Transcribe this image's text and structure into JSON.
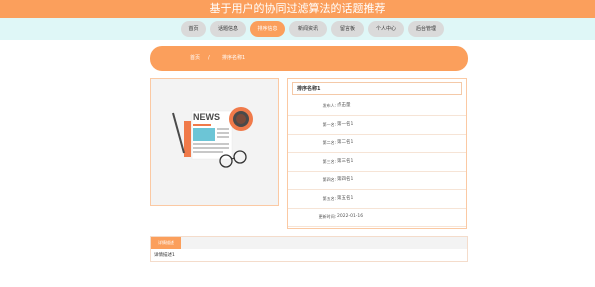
{
  "header": {
    "title": "基于用户的协同过滤算法的话题推荐"
  },
  "nav": {
    "items": [
      {
        "label": "首页",
        "name": "nav-home"
      },
      {
        "label": "话题信息",
        "name": "nav-topic-info"
      },
      {
        "label": "排序信息",
        "name": "nav-ranking-info",
        "active": true
      },
      {
        "label": "新闻资讯",
        "name": "nav-news"
      },
      {
        "label": "留言板",
        "name": "nav-message-board"
      },
      {
        "label": "个人中心",
        "name": "nav-user-center"
      },
      {
        "label": "后台管理",
        "name": "nav-admin"
      }
    ]
  },
  "breadcrumb": {
    "home": "首页",
    "separator": "/",
    "current": "排序名称1"
  },
  "detail": {
    "title": "排序名称1",
    "fields": [
      {
        "label": "发布人:",
        "value": "点击量"
      },
      {
        "label": "第一名:",
        "value": "第一名1"
      },
      {
        "label": "第二名:",
        "value": "第二名1"
      },
      {
        "label": "第三名:",
        "value": "第三名1"
      },
      {
        "label": "第四名:",
        "value": "第四名1"
      },
      {
        "label": "第五名:",
        "value": "第五名1"
      },
      {
        "label": "更新时间:",
        "value": "2022-01-16"
      }
    ]
  },
  "description": {
    "tab": "详情描述",
    "text": "详情描述1"
  },
  "image_alt_text": "NEWS",
  "colors": {
    "accent": "#fb9f5c",
    "nav_band": "#dff7f7",
    "nav_inactive": "#dadada"
  }
}
